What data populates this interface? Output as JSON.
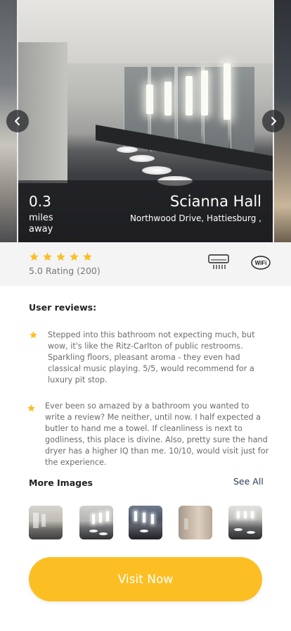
{
  "hero": {
    "distance_value": "0.3",
    "distance_unit_line1": "miles",
    "distance_unit_line2": "away",
    "place_name": "Scianna Hall",
    "place_address": "Northwood Drive, Hattiesburg ,",
    "prev_icon": "chevron-left-icon",
    "next_icon": "chevron-right-icon"
  },
  "rating": {
    "stars": 5,
    "text": "5.0 Rating (200)",
    "star_color": "#fbbf24",
    "amenities": [
      "air-conditioner-icon",
      "wifi-icon"
    ],
    "wifi_label": "WiFi"
  },
  "reviews": {
    "title": "User reviews:",
    "items": [
      "Stepped into this bathroom not expecting much, but wow, it's like the Ritz-Carlton of public restrooms. Sparkling floors, pleasant aroma - they even had classical music playing. 5/5, would recommend for a luxury pit stop.",
      "Ever been so amazed by a bathroom you wanted to write a review? Me neither, until now. I half expected a butler to hand me a towel. If cleanliness is next to godliness, this place is divine. Also, pretty sure the hand dryer has a higher IQ than me. 10/10, would visit just for the experience."
    ]
  },
  "more_images": {
    "title": "More Images",
    "see_all": "See All",
    "count": 5
  },
  "cta": {
    "label": "Visit Now",
    "color": "#fbbf24"
  }
}
